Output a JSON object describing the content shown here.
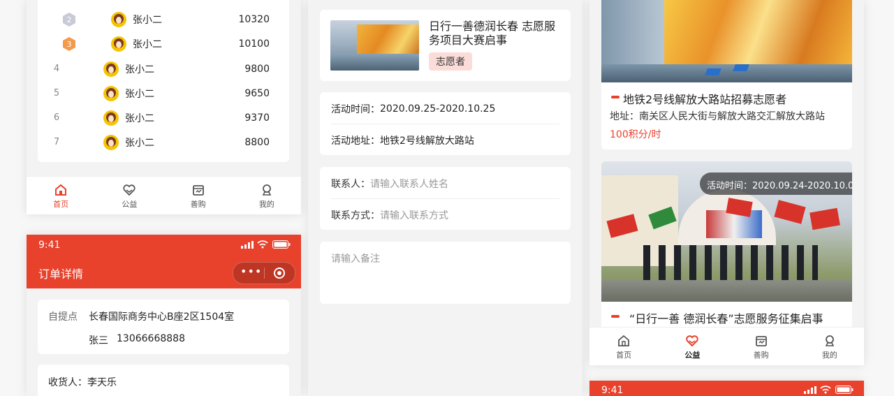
{
  "ranking": {
    "rows": [
      {
        "rank": "2",
        "name": "张小二",
        "score": "10320"
      },
      {
        "rank": "3",
        "name": "张小二",
        "score": "10100"
      },
      {
        "rank": "4",
        "name": "张小二",
        "score": "9800"
      },
      {
        "rank": "5",
        "name": "张小二",
        "score": "9650"
      },
      {
        "rank": "6",
        "name": "张小二",
        "score": "9370"
      },
      {
        "rank": "7",
        "name": "张小二",
        "score": "8800"
      }
    ]
  },
  "tabbar": {
    "home": "首页",
    "charity": "公益",
    "shop": "善购",
    "mine": "我的"
  },
  "order": {
    "time": "9:41",
    "title": "订单详情",
    "pickup_label": "自提点",
    "pickup_address": "长春国际商务中心B座2区1504室",
    "contact_name": "张三",
    "contact_phone": "13066668888",
    "receiver_label": "收货人：",
    "receiver_name": "李天乐"
  },
  "signup": {
    "event_title": "日行一善德润长春 志愿服务项目大赛启事",
    "tag": "志愿者",
    "time_label": "活动时间：",
    "time_value": "2020.09.25-2020.10.25",
    "address_label": "活动地址：",
    "address_value": "地铁2号线解放大路站",
    "contact_label": "联系人：",
    "contact_placeholder": "请输入联系人姓名",
    "phone_label": "联系方式：",
    "phone_placeholder": "请输入联系方式",
    "remark_placeholder": "请输入备注"
  },
  "feed": {
    "item1_title": "地铁2号线解放大路站招募志愿者",
    "item1_address": "地址：南关区人民大街与解放大路交汇解放大路站",
    "item1_points": "100积分/时",
    "item2_time": "活动时间：2020.09.24-2020.10.08",
    "item2_title": "“日行一善 德润长春”志愿服务征集启事",
    "bottom_time": "9:41"
  },
  "colors": {
    "accent": "#e8412c",
    "tag_bg": "#fbdcd8"
  }
}
